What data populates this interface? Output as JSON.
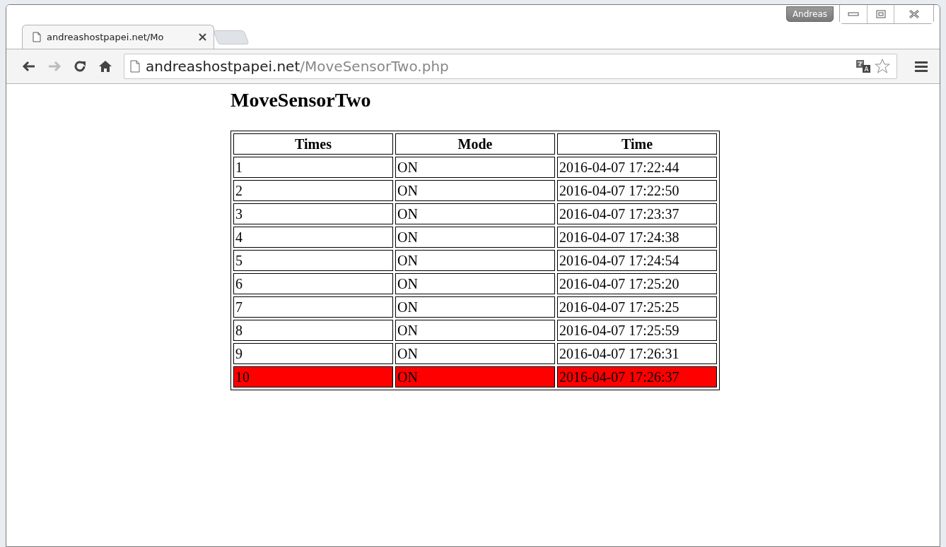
{
  "browser": {
    "profile_name": "Andreas",
    "tab_title": "andreashostpapei.net/Mo",
    "url_host": "andreashostpapei.net",
    "url_path": "/MoveSensorTwo.php"
  },
  "page": {
    "heading": "MoveSensorTwo",
    "table": {
      "columns": [
        "Times",
        "Mode",
        "Time"
      ],
      "rows": [
        {
          "cells": [
            "1",
            "ON",
            "2016-04-07 17:22:44"
          ],
          "highlighted": false
        },
        {
          "cells": [
            "2",
            "ON",
            "2016-04-07 17:22:50"
          ],
          "highlighted": false
        },
        {
          "cells": [
            "3",
            "ON",
            "2016-04-07 17:23:37"
          ],
          "highlighted": false
        },
        {
          "cells": [
            "4",
            "ON",
            "2016-04-07 17:24:38"
          ],
          "highlighted": false
        },
        {
          "cells": [
            "5",
            "ON",
            "2016-04-07 17:24:54"
          ],
          "highlighted": false
        },
        {
          "cells": [
            "6",
            "ON",
            "2016-04-07 17:25:20"
          ],
          "highlighted": false
        },
        {
          "cells": [
            "7",
            "ON",
            "2016-04-07 17:25:25"
          ],
          "highlighted": false
        },
        {
          "cells": [
            "8",
            "ON",
            "2016-04-07 17:25:59"
          ],
          "highlighted": false
        },
        {
          "cells": [
            "9",
            "ON",
            "2016-04-07 17:26:31"
          ],
          "highlighted": false
        },
        {
          "cells": [
            "10",
            "ON",
            "2016-04-07 17:26:37"
          ],
          "highlighted": true
        }
      ]
    }
  }
}
